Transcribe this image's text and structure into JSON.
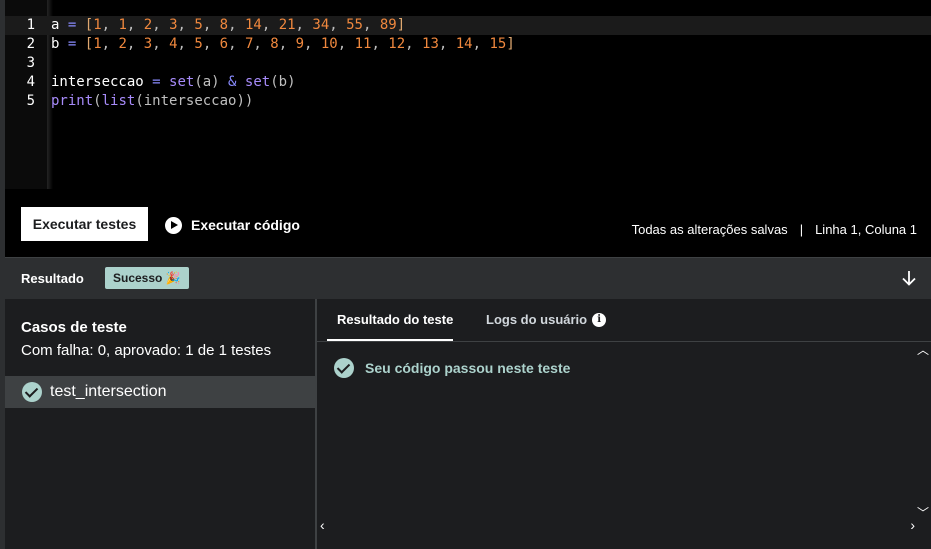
{
  "editor": {
    "lines": [
      {
        "n": "1",
        "tokens": [
          [
            "t-ident",
            "a"
          ],
          [
            "t-cm",
            " "
          ],
          [
            "t-op",
            "="
          ],
          [
            "t-cm",
            " "
          ],
          [
            "t-punc",
            "["
          ],
          [
            "t-num",
            "1"
          ],
          [
            "t-cm",
            ", "
          ],
          [
            "t-num",
            "1"
          ],
          [
            "t-cm",
            ", "
          ],
          [
            "t-num",
            "2"
          ],
          [
            "t-cm",
            ", "
          ],
          [
            "t-num",
            "3"
          ],
          [
            "t-cm",
            ", "
          ],
          [
            "t-num",
            "5"
          ],
          [
            "t-cm",
            ", "
          ],
          [
            "t-num",
            "8"
          ],
          [
            "t-cm",
            ", "
          ],
          [
            "t-num",
            "14"
          ],
          [
            "t-cm",
            ", "
          ],
          [
            "t-num",
            "21"
          ],
          [
            "t-cm",
            ", "
          ],
          [
            "t-num",
            "34"
          ],
          [
            "t-cm",
            ", "
          ],
          [
            "t-num",
            "55"
          ],
          [
            "t-cm",
            ", "
          ],
          [
            "t-num",
            "89"
          ],
          [
            "t-punc",
            "]"
          ]
        ]
      },
      {
        "n": "2",
        "tokens": [
          [
            "t-ident",
            "b"
          ],
          [
            "t-cm",
            " "
          ],
          [
            "t-op",
            "="
          ],
          [
            "t-cm",
            " "
          ],
          [
            "t-punc",
            "["
          ],
          [
            "t-num",
            "1"
          ],
          [
            "t-cm",
            ", "
          ],
          [
            "t-num",
            "2"
          ],
          [
            "t-cm",
            ", "
          ],
          [
            "t-num",
            "3"
          ],
          [
            "t-cm",
            ", "
          ],
          [
            "t-num",
            "4"
          ],
          [
            "t-cm",
            ", "
          ],
          [
            "t-num",
            "5"
          ],
          [
            "t-cm",
            ", "
          ],
          [
            "t-num",
            "6"
          ],
          [
            "t-cm",
            ", "
          ],
          [
            "t-num",
            "7"
          ],
          [
            "t-cm",
            ", "
          ],
          [
            "t-num",
            "8"
          ],
          [
            "t-cm",
            ", "
          ],
          [
            "t-num",
            "9"
          ],
          [
            "t-cm",
            ", "
          ],
          [
            "t-num",
            "10"
          ],
          [
            "t-cm",
            ", "
          ],
          [
            "t-num",
            "11"
          ],
          [
            "t-cm",
            ", "
          ],
          [
            "t-num",
            "12"
          ],
          [
            "t-cm",
            ", "
          ],
          [
            "t-num",
            "13"
          ],
          [
            "t-cm",
            ", "
          ],
          [
            "t-num",
            "14"
          ],
          [
            "t-cm",
            ", "
          ],
          [
            "t-num",
            "15"
          ],
          [
            "t-punc",
            "]"
          ]
        ]
      },
      {
        "n": "3",
        "tokens": []
      },
      {
        "n": "4",
        "tokens": [
          [
            "t-ident",
            "interseccao"
          ],
          [
            "t-cm",
            " "
          ],
          [
            "t-op",
            "="
          ],
          [
            "t-cm",
            " "
          ],
          [
            "t-func",
            "set"
          ],
          [
            "t-cm",
            "(a) "
          ],
          [
            "t-op",
            "&"
          ],
          [
            "t-cm",
            " "
          ],
          [
            "t-func",
            "set"
          ],
          [
            "t-cm",
            "(b)"
          ]
        ]
      },
      {
        "n": "5",
        "tokens": [
          [
            "t-func",
            "print"
          ],
          [
            "t-cm",
            "("
          ],
          [
            "t-func",
            "list"
          ],
          [
            "t-cm",
            "(interseccao))"
          ]
        ]
      }
    ]
  },
  "toolbar": {
    "run_tests_label": "Executar testes",
    "run_code_label": "Executar código",
    "save_status": "Todas as alterações salvas",
    "separator": "|",
    "cursor_position": "Linha 1, Coluna 1"
  },
  "result_bar": {
    "title": "Resultado",
    "badge": "Sucesso 🎉"
  },
  "cases": {
    "title": "Casos de teste",
    "summary": "Com falha: 0, aprovado: 1 de 1 testes",
    "items": [
      {
        "label": "test_intersection"
      }
    ]
  },
  "right_panel": {
    "tabs": [
      {
        "label": "Resultado do teste"
      },
      {
        "label": "Logs do usuário"
      }
    ],
    "pass_message": "Seu código passou neste teste"
  },
  "colors": {
    "accent_success": "#acd2cc",
    "number": "#f0883e",
    "function": "#a78bfa",
    "operator": "#8a8cff"
  }
}
